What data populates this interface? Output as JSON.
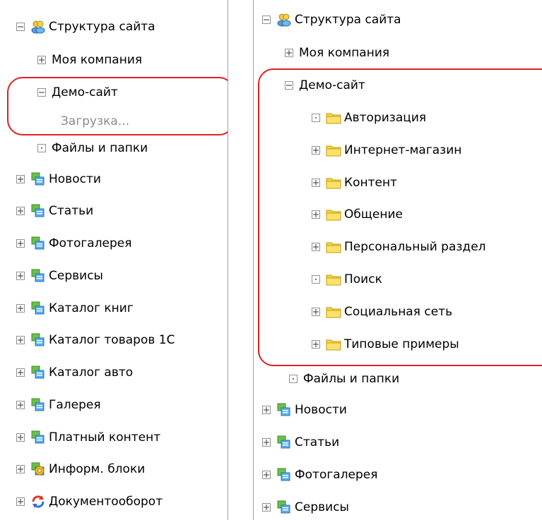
{
  "left_tree": {
    "root_label": "Структура сайта",
    "my_company": "Моя компания",
    "demo_site": "Демо-сайт",
    "loading": "Загрузка...",
    "files": "Файлы и папки",
    "sections": [
      "Новости",
      "Статьи",
      "Фотогалерея",
      "Сервисы",
      "Каталог книг",
      "Каталог товаров 1С",
      "Каталог авто",
      "Галерея",
      "Платный контент",
      "Информ. блоки",
      "Документооборот"
    ]
  },
  "right_tree": {
    "root_label": "Структура сайта",
    "my_company": "Моя компания",
    "demo_site": "Демо-сайт",
    "folders": [
      "Авторизация",
      "Интернет-магазин",
      "Контент",
      "Общение",
      "Персональный раздел",
      "Поиск",
      "Социальная сеть",
      "Типовые примеры"
    ],
    "files": "Файлы и папки",
    "sections": [
      "Новости",
      "Статьи",
      "Фотогалерея",
      "Сервисы"
    ]
  },
  "colors": {
    "highlight": "#e02020",
    "folder": "#f7d63d",
    "iblock_green": "#6cc04a",
    "iblock_blue": "#5aaee8"
  }
}
